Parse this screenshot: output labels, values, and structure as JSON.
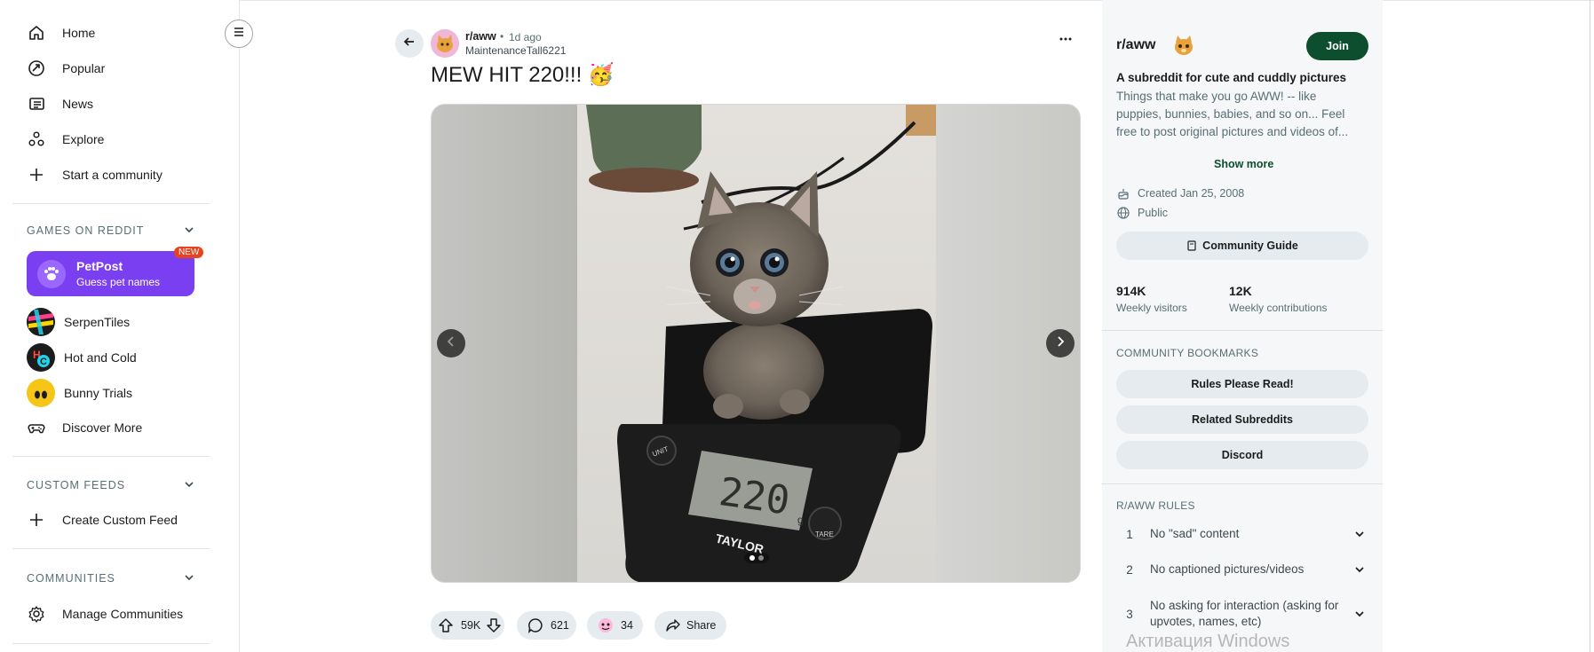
{
  "nav": {
    "items": [
      {
        "label": "Home",
        "icon": "home-icon"
      },
      {
        "label": "Popular",
        "icon": "popular-icon"
      },
      {
        "label": "News",
        "icon": "news-icon"
      },
      {
        "label": "Explore",
        "icon": "explore-icon"
      },
      {
        "label": "Start a community",
        "icon": "plus-icon"
      }
    ],
    "games_section": "GAMES ON REDDIT",
    "petpost": {
      "title": "PetPost",
      "subtitle": "Guess pet names",
      "badge": "NEW"
    },
    "games": [
      {
        "label": "SerpenTiles"
      },
      {
        "label": "Hot and Cold"
      },
      {
        "label": "Bunny Trials"
      },
      {
        "label": "Discover More"
      }
    ],
    "custom_feeds_section": "CUSTOM FEEDS",
    "create_custom_feed": "Create Custom Feed",
    "communities_section": "COMMUNITIES",
    "manage_communities": "Manage Communities"
  },
  "post": {
    "subreddit": "r/aww",
    "separator": "•",
    "time": "1d ago",
    "author": "MaintenanceTall6221",
    "title": "MEW HIT 220!!! 🥳",
    "scale_display": "220",
    "scale_unit_label": "g",
    "scale_brand": "TAYLOR",
    "scale_unit_button": "UNIT",
    "scale_tare_button": "TARE",
    "actions": {
      "votes": "59K",
      "comments": "621",
      "awards": "34",
      "share": "Share"
    }
  },
  "sidebar": {
    "title": "r/aww",
    "join": "Join",
    "heading": "A subreddit for cute and cuddly pictures",
    "description": "Things that make you go AWW! -- like puppies, bunnies, babies, and so on... Feel free to post original pictures and videos of...",
    "show_more": "Show more",
    "created": "Created Jan 25, 2008",
    "visibility": "Public",
    "community_guide": "Community Guide",
    "stats": [
      {
        "value": "914K",
        "label": "Weekly visitors"
      },
      {
        "value": "12K",
        "label": "Weekly contributions"
      }
    ],
    "bookmarks_section": "COMMUNITY BOOKMARKS",
    "bookmarks": [
      "Rules Please Read!",
      "Related Subreddits",
      "Discord"
    ],
    "rules_section": "R/AWW RULES",
    "rules": [
      {
        "num": "1",
        "text": "No \"sad\" content"
      },
      {
        "num": "2",
        "text": "No captioned pictures/videos"
      },
      {
        "num": "3",
        "text": "No asking for interaction (asking for upvotes, names, etc)"
      }
    ]
  },
  "watermark": "Активация Windows",
  "colors": {
    "accent": "#0d4e2f",
    "petpost": "#7b3ff2",
    "badge": "#e8421f"
  }
}
